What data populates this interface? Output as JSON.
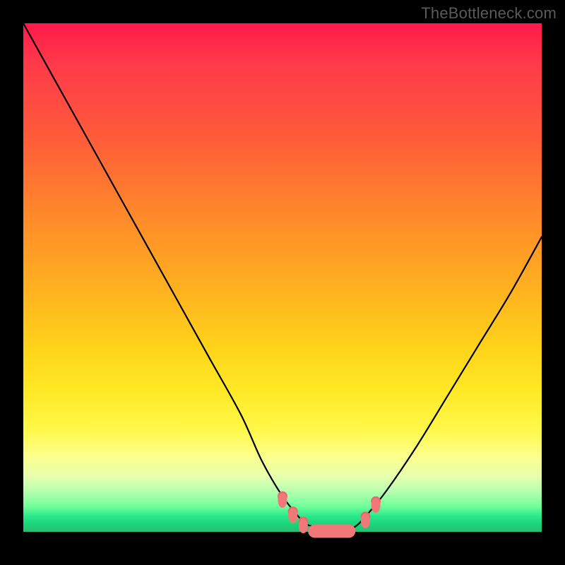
{
  "watermark": "TheBottleneck.com",
  "colors": {
    "frame": "#000000",
    "curve": "#000000",
    "marker": "#f07878",
    "gradient_top": "#ff1a4a",
    "gradient_bottom": "#28bf70"
  },
  "chart_data": {
    "type": "line",
    "title": "",
    "xlabel": "",
    "ylabel": "",
    "xlim": [
      0,
      100
    ],
    "ylim": [
      0,
      100
    ],
    "series": [
      {
        "name": "bottleneck-curve",
        "x": [
          0,
          6,
          12,
          18,
          24,
          30,
          36,
          42,
          46,
          50,
          54,
          56,
          58,
          60,
          62,
          64,
          66,
          70,
          76,
          82,
          88,
          94,
          100
        ],
        "y": [
          100,
          89,
          78,
          67,
          56,
          45,
          34,
          23,
          14,
          7,
          2,
          1,
          0,
          0,
          0,
          1,
          3,
          8,
          17,
          27,
          37,
          47,
          58
        ]
      }
    ],
    "markers": {
      "name": "highlight-points",
      "x": [
        50,
        52,
        54,
        56,
        58,
        60,
        62,
        64,
        66,
        68
      ],
      "y": [
        7,
        4,
        2,
        1,
        0,
        0,
        0,
        1,
        3,
        6
      ]
    },
    "annotations": []
  }
}
